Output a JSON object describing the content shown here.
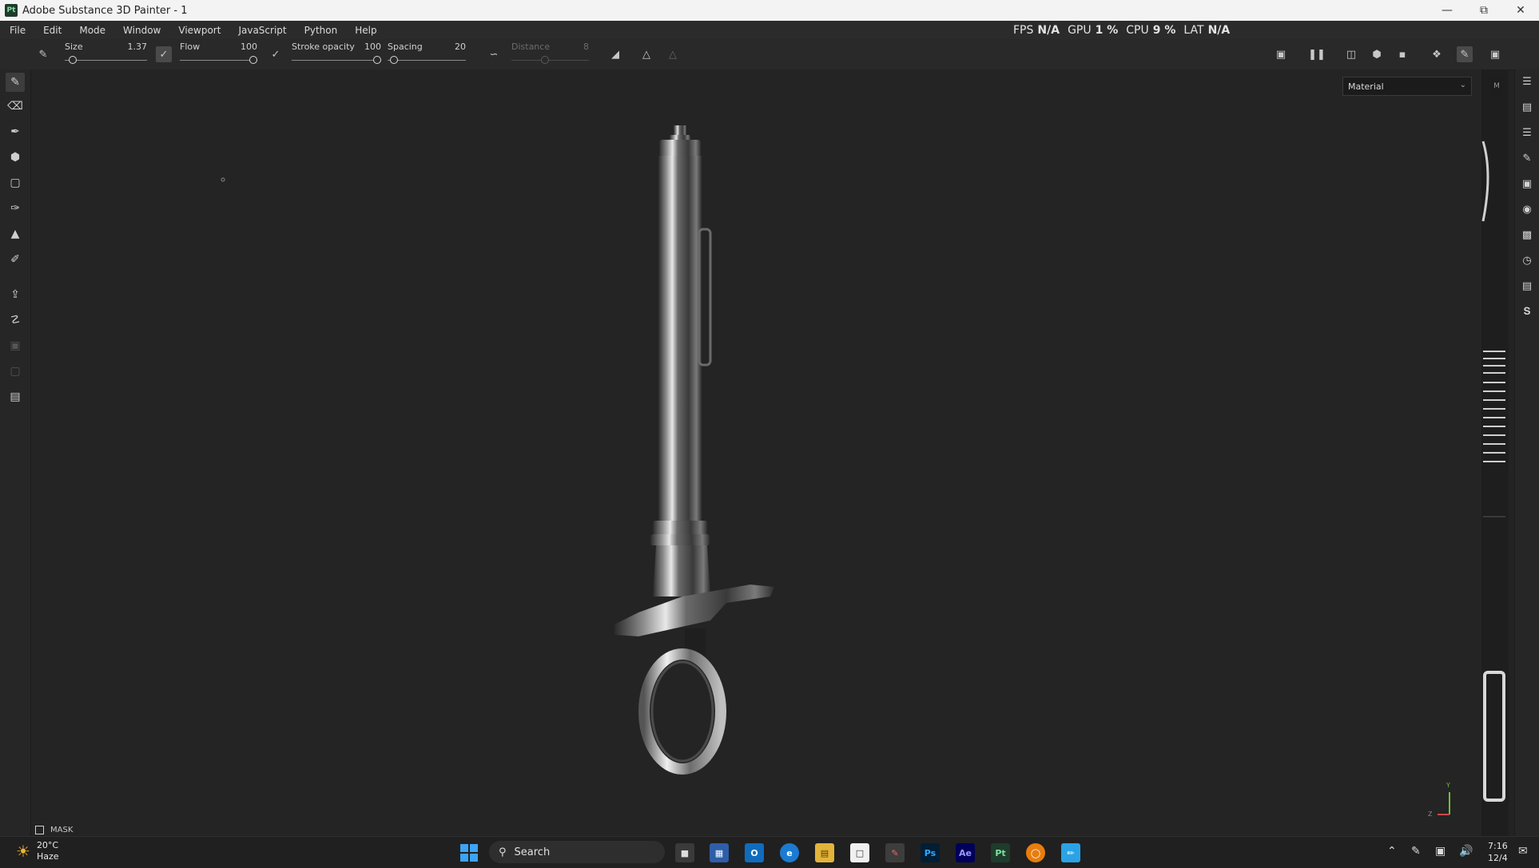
{
  "window": {
    "app_icon": "Pt",
    "title": "Adobe Substance 3D Painter - 1",
    "controls": [
      "minimize-icon",
      "restore-icon",
      "close-icon"
    ]
  },
  "menu": {
    "items": [
      "File",
      "Edit",
      "Mode",
      "Window",
      "Viewport",
      "JavaScript",
      "Python",
      "Help"
    ]
  },
  "perf": {
    "fps_label": "FPS",
    "fps_value": "N/A",
    "gpu_label": "GPU",
    "gpu_value": "1 %",
    "cpu_label": "CPU",
    "cpu_value": "9 %",
    "lat_label": "LAT",
    "lat_value": "N/A"
  },
  "tool_options": {
    "size": {
      "label": "Size",
      "value": "1.37",
      "level": 0.05
    },
    "flow": {
      "label": "Flow",
      "value": "100",
      "level": 1.0
    },
    "stroke_opacity": {
      "label": "Stroke opacity",
      "value": "100",
      "level": 1.0
    },
    "spacing": {
      "label": "Spacing",
      "value": "20",
      "level": 0.03
    },
    "distance": {
      "label": "Distance",
      "value": "8",
      "level": 0.43
    }
  },
  "viewport": {
    "material_dropdown": "Material",
    "side_stub": "M",
    "mask_label": "MASK",
    "gizmo": {
      "y": "Y",
      "z": "Z"
    }
  },
  "taskbar": {
    "weather_temp": "20°C",
    "weather_desc": "Haze",
    "search_label": "Search",
    "apps": [
      {
        "name": "ps",
        "label": "Ps",
        "color": "#31a8ff",
        "bg": "#001e36"
      },
      {
        "name": "ae",
        "label": "Ae",
        "color": "#9999ff",
        "bg": "#00005b"
      },
      {
        "name": "pt",
        "label": "Pt",
        "color": "#7fe0a0",
        "bg": "#1e3b2c"
      }
    ],
    "time": "7:16",
    "date": "12/4"
  },
  "colors": {
    "viewport_bg": "#242424",
    "accent": "#3ea3f5"
  }
}
